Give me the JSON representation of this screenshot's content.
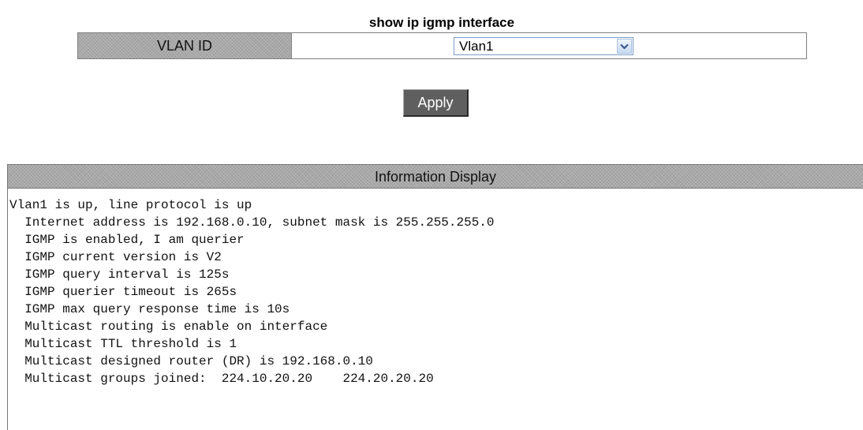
{
  "form": {
    "title": "show ip igmp interface",
    "vlan_label": "VLAN ID",
    "vlan_selected": "Vlan1",
    "apply_label": "Apply"
  },
  "info": {
    "header": "Information Display",
    "lines": [
      "Vlan1 is up, line protocol is up",
      "  Internet address is 192.168.0.10, subnet mask is 255.255.255.0",
      "  IGMP is enabled, I am querier",
      "  IGMP current version is V2",
      "  IGMP query interval is 125s",
      "  IGMP querier timeout is 265s",
      "  IGMP max query response time is 10s",
      "  Multicast routing is enable on interface",
      "  Multicast TTL threshold is 1",
      "  Multicast designed router (DR) is 192.168.0.10",
      "  Multicast groups joined:  224.10.20.20    224.20.20.20"
    ]
  },
  "icons": {
    "dropdown": "chevron-down-icon"
  }
}
